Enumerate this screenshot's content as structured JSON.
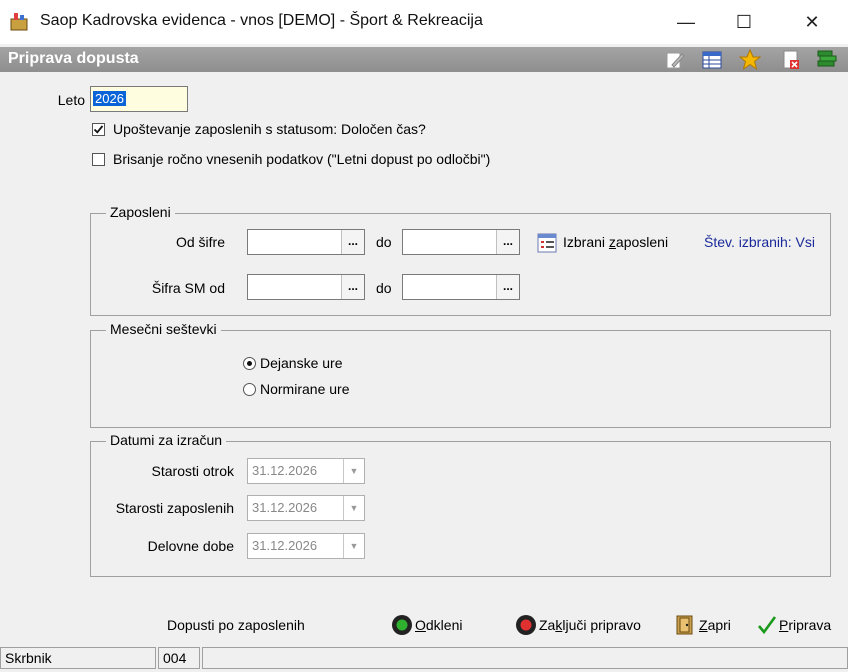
{
  "window": {
    "title": "Saop Kadrovska evidenca - vnos [DEMO] - Šport & Rekreacija",
    "minimize": "—",
    "maximize": "☐",
    "close": "✕"
  },
  "header": {
    "title": "Priprava dopusta",
    "toolbar_icons": [
      "edit-icon",
      "table-icon",
      "star-icon",
      "delete-doc-icon",
      "books-icon"
    ]
  },
  "form": {
    "leto_label": "Leto",
    "leto_value": "2026",
    "chk_statusom_label": "Upoštevanje zaposlenih s statusom: Določen čas?",
    "chk_statusom_checked": true,
    "chk_brisanje_label": "Brisanje ročno vnesenih podatkov (\"Letni dopust po odločbi\")",
    "chk_brisanje_checked": false
  },
  "zaposleni": {
    "legend": "Zaposleni",
    "od_sifre_label": "Od šifre",
    "do_label": "do",
    "sifra_sm_label": "Šifra SM od",
    "lookup_dots": "...",
    "izbrani_prefix": "Izbrani ",
    "izbrani_underlined": "z",
    "izbrani_suffix": "aposleni",
    "stev_izbranih": "Štev. izbranih: Vsi"
  },
  "mesecni": {
    "legend": "Mesečni seštevki",
    "options": [
      "Dejanske ure",
      "Normirane ure"
    ],
    "selected": "Dejanske ure"
  },
  "datumi": {
    "legend": "Datumi za izračun",
    "rows": [
      {
        "label": "Starosti otrok",
        "value": "31.12.2026"
      },
      {
        "label": "Starosti zaposlenih",
        "value": "31.12.2026"
      },
      {
        "label": "Delovne dobe",
        "value": "31.12.2026"
      }
    ]
  },
  "footer": {
    "dopusti_label": "Dopusti po zaposlenih",
    "odkleni_u": "O",
    "odkleni_rest": "dkleni",
    "zakljuci_pre": "Za",
    "zakljuci_u": "k",
    "zakljuci_rest": "ljuči pripravo",
    "zapri_u": "Z",
    "zapri_rest": "apri",
    "priprava_u": "P",
    "priprava_rest": "riprava"
  },
  "status": {
    "user": "Skrbnik",
    "code": "004"
  }
}
